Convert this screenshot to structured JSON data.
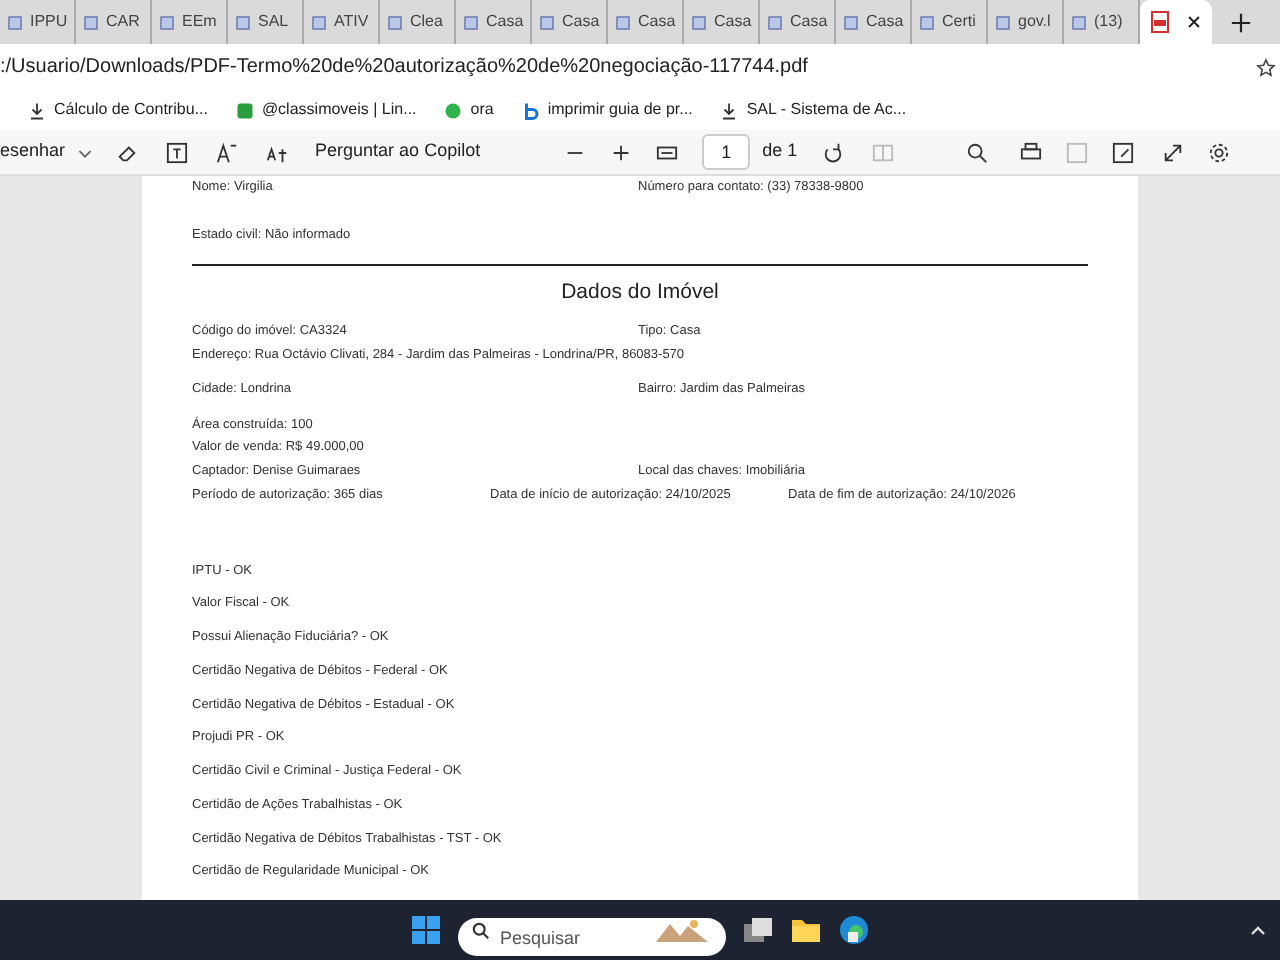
{
  "tabs": [
    {
      "label": "IPPU",
      "selected": false
    },
    {
      "label": "CAR",
      "selected": false
    },
    {
      "label": "EEm",
      "selected": false
    },
    {
      "label": "SAL",
      "selected": false
    },
    {
      "label": "ATIV",
      "selected": false
    },
    {
      "label": "Clea",
      "selected": false
    },
    {
      "label": "Casa",
      "selected": false
    },
    {
      "label": "Casa",
      "selected": false
    },
    {
      "label": "Casa",
      "selected": false
    },
    {
      "label": "Casa",
      "selected": false
    },
    {
      "label": "Casa",
      "selected": false
    },
    {
      "label": "Casa",
      "selected": false
    },
    {
      "label": "Certi",
      "selected": false
    },
    {
      "label": "gov.l",
      "selected": false
    },
    {
      "label": "(13)",
      "selected": false
    },
    {
      "selected": true
    }
  ],
  "address": ":/Usuario/Downloads/PDF-Termo%20de%20autorização%20de%20negociação-117744.pdf",
  "bookmarks": [
    "Cálculo de Contribu...",
    "@classimoveis | Lin...",
    "ora",
    "imprimir guia de pr...",
    "SAL - Sistema de Ac..."
  ],
  "pdf_toolbar": {
    "draw_label": "esenhar",
    "copilot": "Perguntar ao Copilot",
    "page": "1",
    "page_count": "de 1"
  },
  "document": {
    "top_rows": [
      [
        "Nome: Virgilia",
        "Número para contato: (33) 78338-9800"
      ],
      [
        "Estado civil: Não informado"
      ]
    ],
    "heading": "Dados do Imóvel",
    "property_rows": [
      [
        "Código do imóvel: CA3324",
        "Tipo: Casa"
      ],
      [
        "Endereço: Rua Octávio Clivati, 284 - Jardim das Palmeiras - Londrina/PR, 86083-570"
      ],
      [
        "Cidade: Londrina",
        "Bairro: Jardim das Palmeiras"
      ],
      [
        "Área construída: 100"
      ],
      [
        "Valor de venda: R$ 49.000,00"
      ],
      [
        "Captador: Denise Guimaraes",
        "Local das chaves: Imobiliária"
      ],
      [
        "Período de autorização: 365 dias",
        "Data de início de autorização: 24/10/2025",
        "Data de fim de autorização: 24/10/2026"
      ]
    ],
    "checks": [
      "IPTU - OK",
      "Valor Fiscal - OK",
      "Possui Alienação Fiduciária? - OK",
      "Certidão Negativa de Débitos - Federal - OK",
      "Certidão Negativa de Débitos - Estadual - OK",
      "Projudi PR - OK",
      "Certidão Civil e Criminal - Justiça Federal - OK",
      "Certidão de Ações Trabalhistas - OK",
      "Certidão Negativa de Débitos Trabalhistas - TST - OK",
      "Certidão de Regularidade Municipal - OK"
    ]
  },
  "taskbar": {
    "search_placeholder": "Pesquisar"
  }
}
